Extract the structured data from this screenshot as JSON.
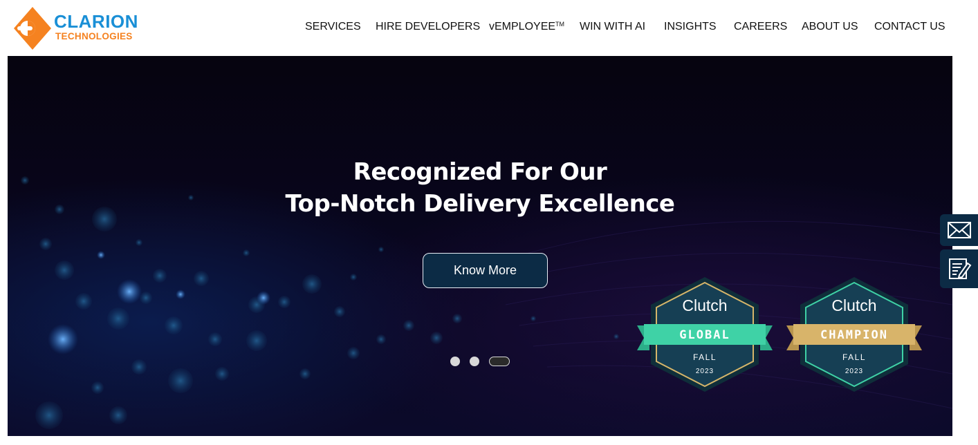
{
  "brand": {
    "name": "CLARION",
    "tagline": "TECHNOLOGIES",
    "colors": {
      "blue": "#1a8fd6",
      "orange": "#f58220"
    }
  },
  "nav": {
    "items": [
      {
        "label": "SERVICES"
      },
      {
        "label": "HIRE DEVELOPERS"
      },
      {
        "label": "vEMPLOYEE",
        "superscript": "TM"
      },
      {
        "label": "WIN WITH AI"
      },
      {
        "label": "INSIGHTS"
      },
      {
        "label": "CAREERS"
      },
      {
        "label": "ABOUT US"
      },
      {
        "label": "CONTACT US"
      }
    ]
  },
  "hero": {
    "title_line1": "Recognized For Our",
    "title_line2": "Top-Notch Delivery Excellence",
    "cta_label": "Know More",
    "slides_total": 3,
    "active_slide": 3
  },
  "badges": [
    {
      "brand": "Clutch",
      "ribbon": "GLOBAL",
      "season": "FALL",
      "year": "2023",
      "ribbon_color": "#3fd2a6"
    },
    {
      "brand": "Clutch",
      "ribbon": "CHAMPION",
      "season": "FALL",
      "year": "2023",
      "ribbon_color": "#d8b46a"
    }
  ],
  "side_actions": [
    {
      "icon": "envelope-icon"
    },
    {
      "icon": "form-edit-icon"
    }
  ],
  "colors": {
    "navy": "#0c2b45",
    "hero_bg": "#090620"
  }
}
